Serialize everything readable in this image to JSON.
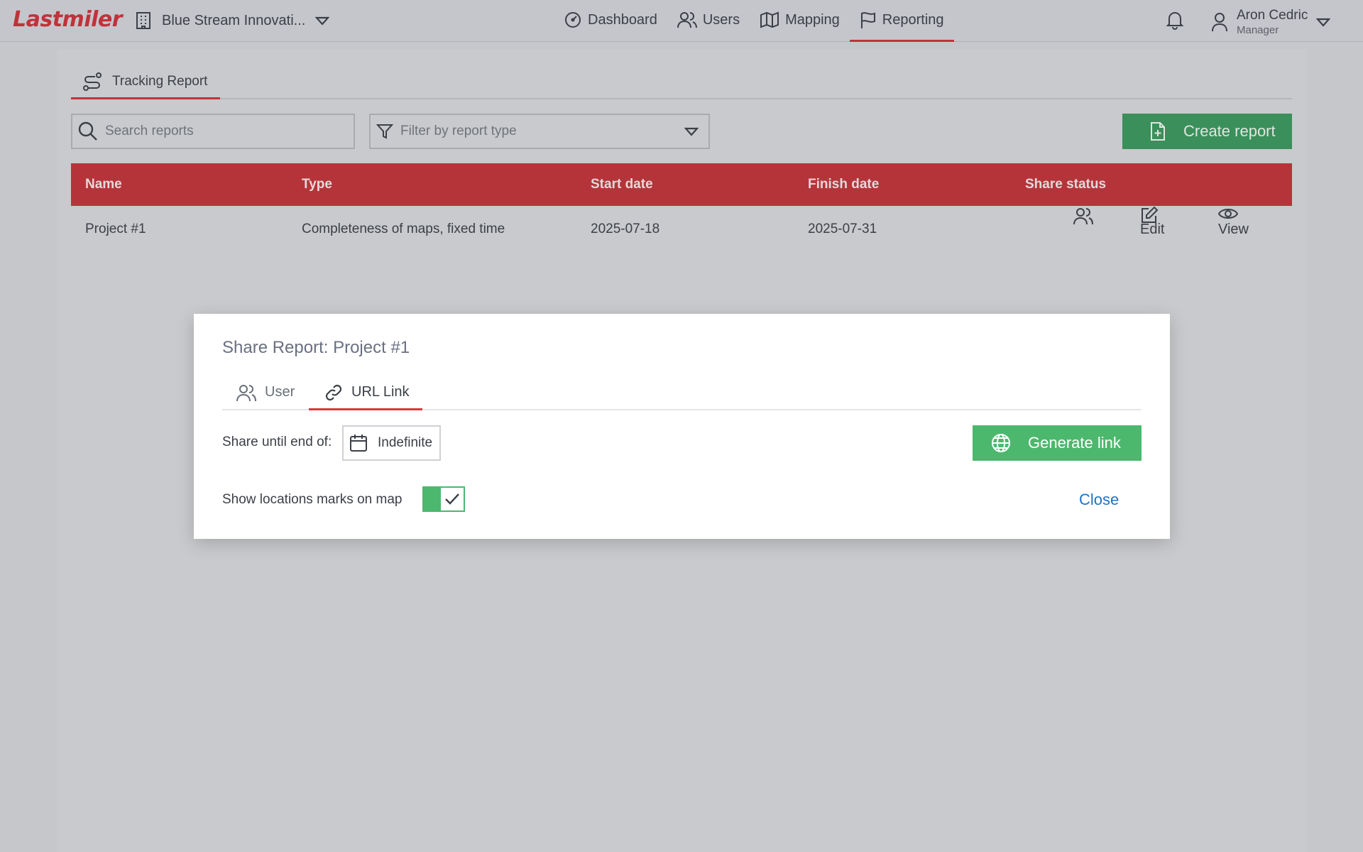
{
  "app": {
    "logo": "Lastmiler"
  },
  "org": {
    "name": "Blue Stream Innovati..."
  },
  "nav": {
    "items": [
      {
        "label": "Dashboard",
        "icon": "gauge-icon"
      },
      {
        "label": "Users",
        "icon": "users-icon"
      },
      {
        "label": "Mapping",
        "icon": "map-icon"
      },
      {
        "label": "Reporting",
        "icon": "flag-icon",
        "active": true
      }
    ]
  },
  "user": {
    "name": "Aron Cedric",
    "role": "Manager"
  },
  "page": {
    "tab_label": "Tracking Report",
    "search_placeholder": "Search reports",
    "filter_placeholder": "Filter by report type",
    "create_label": "Create report"
  },
  "table": {
    "columns": [
      "Name",
      "Type",
      "Start date",
      "Finish date",
      "Share status"
    ],
    "rows": [
      {
        "name": "Project #1",
        "type": "Completeness of maps, fixed time",
        "start": "2025-07-18",
        "finish": "2025-07-31",
        "edit_label": "Edit",
        "view_label": "View"
      }
    ]
  },
  "modal": {
    "title": "Share Report: Project #1",
    "tabs": [
      {
        "label": "User",
        "active": false
      },
      {
        "label": "URL Link",
        "active": true
      }
    ],
    "share_until_label": "Share until end of:",
    "share_until_value": "Indefinite",
    "generate_label": "Generate link",
    "show_marks_label": "Show locations marks on map",
    "show_marks_enabled": true,
    "close_label": "Close"
  },
  "colors": {
    "brand": "#c0323b",
    "table_header": "#b5343a",
    "primary_green": "#4cb86e",
    "link_blue": "#1f73c2"
  }
}
